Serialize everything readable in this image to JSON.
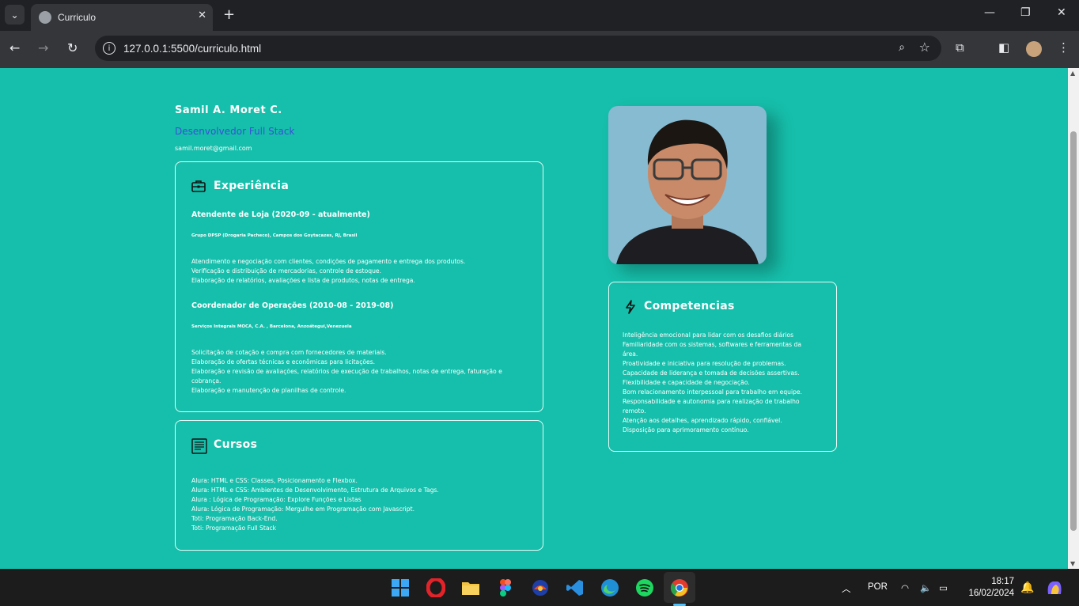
{
  "browser": {
    "tab_title": "Curriculo",
    "url": "127.0.0.1:5500/curriculo.html"
  },
  "profile": {
    "name": "Samil A. Moret C.",
    "role": "Desenvolvedor Full Stack",
    "email": "samil.moret@gmail.com"
  },
  "experience": {
    "heading": "Experiência",
    "jobs": [
      {
        "title": "Atendente de Loja (2020-09 - atualmente)",
        "company": "Grupo DPSP (Drogaria Pacheco), Campos dos Goytacazes, RJ, Brasil",
        "lines": [
          "Atendimento e negociação com clientes, condições de pagamento e entrega dos produtos.",
          "Verificação e distribuição de mercadorias, controle de estoque.",
          "Elaboração de relatórios, avaliações e lista de produtos, notas de entrega."
        ]
      },
      {
        "title": "Coordenador de Operações (2010-08 - 2019-08)",
        "company": "Serviços Integrais MOCA, C.A. , Barcelona, Anzoátegui,Venezuela",
        "lines": [
          "Solicitação de cotação e compra com fornecedores de materiais.",
          "Elaboração de ofertas técnicas e econômicas para licitações.",
          "Elaboração e revisão de avaliações, relatórios de execução de trabalhos, notas de entrega, faturação e",
          "cobrança.",
          "Elaboração e manutenção de planilhas de controle."
        ]
      }
    ]
  },
  "courses": {
    "heading": "Cursos",
    "lines": [
      "Alura: HTML e CSS: Classes, Posicionamento e Flexbox.",
      "Alura: HTML e CSS: Ambientes de Desenvolvimento, Estrutura de Arquivos e Tags.",
      "Alura : Lógica de Programação: Explore Funções e Listas",
      "Alura: Lógica de Programação: Mergulhe em Programação com Javascript.",
      "Toti: Programação Back-End.",
      "Toti: Programação Full Stack"
    ]
  },
  "skills": {
    "heading": "Competencias",
    "lines": [
      "Inteligência emocional para lidar com os desafios diários",
      "Familiaridade com os sistemas, softwares e ferramentas da",
      "área.",
      "Proatividade e iniciativa para resolução de problemas.",
      "Capacidade de liderança e tomada de decisões assertivas.",
      "Flexibilidade e capacidade de negociação.",
      "Bom relacionamento interpessoal para trabalho em equipe.",
      "Responsabilidade e autonomia para realização de trabalho",
      "remoto.",
      "Atenção aos detalhes, aprendizado rápido, confiável.",
      "Disposição para aprimoramento contínuo."
    ]
  },
  "taskbar": {
    "language": "POR",
    "time": "18:17",
    "date": "16/02/2024",
    "apps": [
      "windows-start",
      "opera",
      "file-explorer",
      "figma",
      "app-5",
      "vscode",
      "edge",
      "spotify",
      "chrome"
    ]
  },
  "colors": {
    "page_bg": "#16bfab",
    "role_text": "#3a4ed8",
    "photo_bg": "#86bbd2"
  }
}
